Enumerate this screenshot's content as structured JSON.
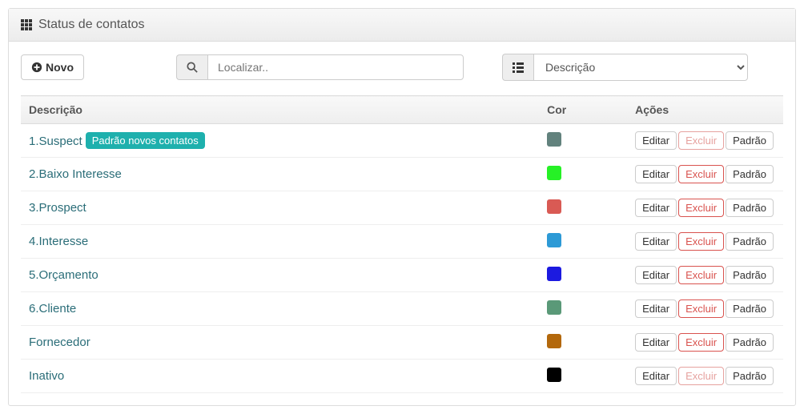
{
  "panel": {
    "title": "Status de contatos"
  },
  "toolbar": {
    "newLabel": "Novo",
    "searchPlaceholder": "Localizar..",
    "sortSelected": "Descrição"
  },
  "columns": {
    "descricao": "Descrição",
    "cor": "Cor",
    "acoes": "Ações"
  },
  "badge": {
    "defaultNewContacts": "Padrão novos contatos"
  },
  "actions": {
    "edit": "Editar",
    "delete": "Excluir",
    "default": "Padrão"
  },
  "rows": [
    {
      "label": "1.Suspect",
      "color": "#62827d",
      "isDefault": true,
      "deleteEnabled": false
    },
    {
      "label": "2.Baixo Interesse",
      "color": "#26f126",
      "isDefault": false,
      "deleteEnabled": true
    },
    {
      "label": "3.Prospect",
      "color": "#d95a54",
      "isDefault": false,
      "deleteEnabled": true
    },
    {
      "label": "4.Interesse",
      "color": "#2d9ad6",
      "isDefault": false,
      "deleteEnabled": true
    },
    {
      "label": "5.Orçamento",
      "color": "#1c1ae0",
      "isDefault": false,
      "deleteEnabled": true
    },
    {
      "label": "6.Cliente",
      "color": "#5a9978",
      "isDefault": false,
      "deleteEnabled": true
    },
    {
      "label": "Fornecedor",
      "color": "#b3680c",
      "isDefault": false,
      "deleteEnabled": true
    },
    {
      "label": "Inativo",
      "color": "#000000",
      "isDefault": false,
      "deleteEnabled": false
    }
  ]
}
